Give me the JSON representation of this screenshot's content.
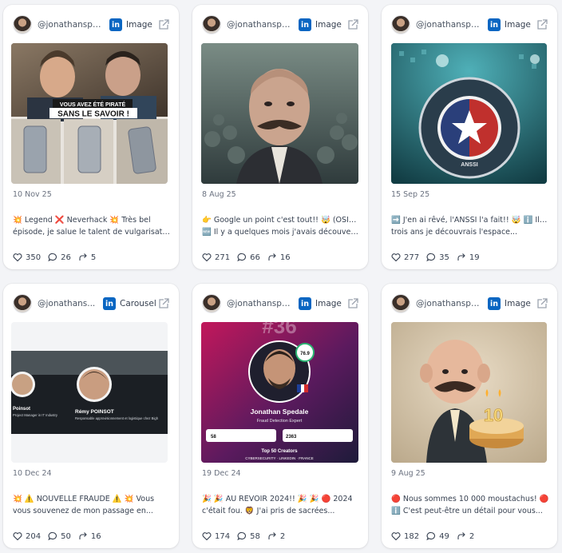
{
  "cards": [
    {
      "handle": "@jonathanspe...",
      "type": "Image",
      "date": "10 Nov 25",
      "line1": "💥 Legend ❌ Neverhack 💥 Très bel",
      "line2": "épisode, je salue le talent de vulgarisatio...",
      "likes": "350",
      "comments": "26",
      "shares": "5",
      "media_text_1": "VOUS AVEZ ÉTÉ PIRATÉ",
      "media_text_2": "SANS LE SAVOIR !"
    },
    {
      "handle": "@jonathanspe...",
      "type": "Image",
      "date": "8 Aug 25",
      "line1": "👉 Google un point c'est tout!! 🤯 (OSINT)",
      "line2": "🆕 Il y a quelques mois j'avais découvert...",
      "likes": "271",
      "comments": "66",
      "shares": "16"
    },
    {
      "handle": "@jonathanspe...",
      "type": "Image",
      "date": "15 Sep 25",
      "line1": "➡️ J'en ai rêvé, l'ANSSI l'a fait!! 🤯 ℹ️ Il y a",
      "line2": "trois ans je découvrais l'espace...",
      "likes": "277",
      "comments": "35",
      "shares": "19",
      "media_text_1": "AGENCE NATIONALE DE LA SÉCURITÉ DES SYSTÈMES D'INFORMATION",
      "media_text_2": "ANSSI"
    },
    {
      "handle": "@jonathans...",
      "type": "Carousel",
      "date": "10 Dec 24",
      "line1": "💥 ⚠️ NOUVELLE FRAUDE ⚠️ 💥  Vous",
      "line2": "vous souvenez de mon passage en...",
      "likes": "204",
      "comments": "50",
      "shares": "16",
      "media_text_1": "Rémy POINSOT",
      "media_text_2": "Responsable approvisionnement et logistique chez Bigh",
      "media_text_3": "Poinsot",
      "media_text_4": "Project Manager in IT Industry"
    },
    {
      "handle": "@jonathanspe...",
      "type": "Image",
      "date": "19 Dec 24",
      "line1": "🎉 🎉 AU REVOIR 2024!! 🎉 🎉 🔴 2024",
      "line2": "c'était fou. 🦁 J'ai pris de sacrées...",
      "likes": "174",
      "comments": "58",
      "shares": "2",
      "media_text_1": "#36",
      "media_text_2": "Jonathan Spedale",
      "media_text_3": "Fraud Detection Expert",
      "media_text_4": "Top 50 Creators",
      "media_text_5": "CYBERSECURITY · LINKEDIN · FRANCE",
      "media_text_6": "76.9",
      "media_text_7": "58",
      "media_text_8": "2363"
    },
    {
      "handle": "@jonathanspe...",
      "type": "Image",
      "date": "9 Aug 25",
      "line1": "🔴 Nous sommes 10 000 moustachus! 🔴",
      "line2": "ℹ️ C'est peut-être un détail pour vous...",
      "likes": "182",
      "comments": "49",
      "shares": "2",
      "media_text_1": "10"
    }
  ],
  "colors": {
    "linkedin": "#0a66c2",
    "accent_red": "#e03b3b"
  },
  "icons": {
    "like": "heart-icon",
    "comment": "comment-icon",
    "share": "share-icon",
    "open": "external-link-icon",
    "network": "linkedin-icon"
  }
}
